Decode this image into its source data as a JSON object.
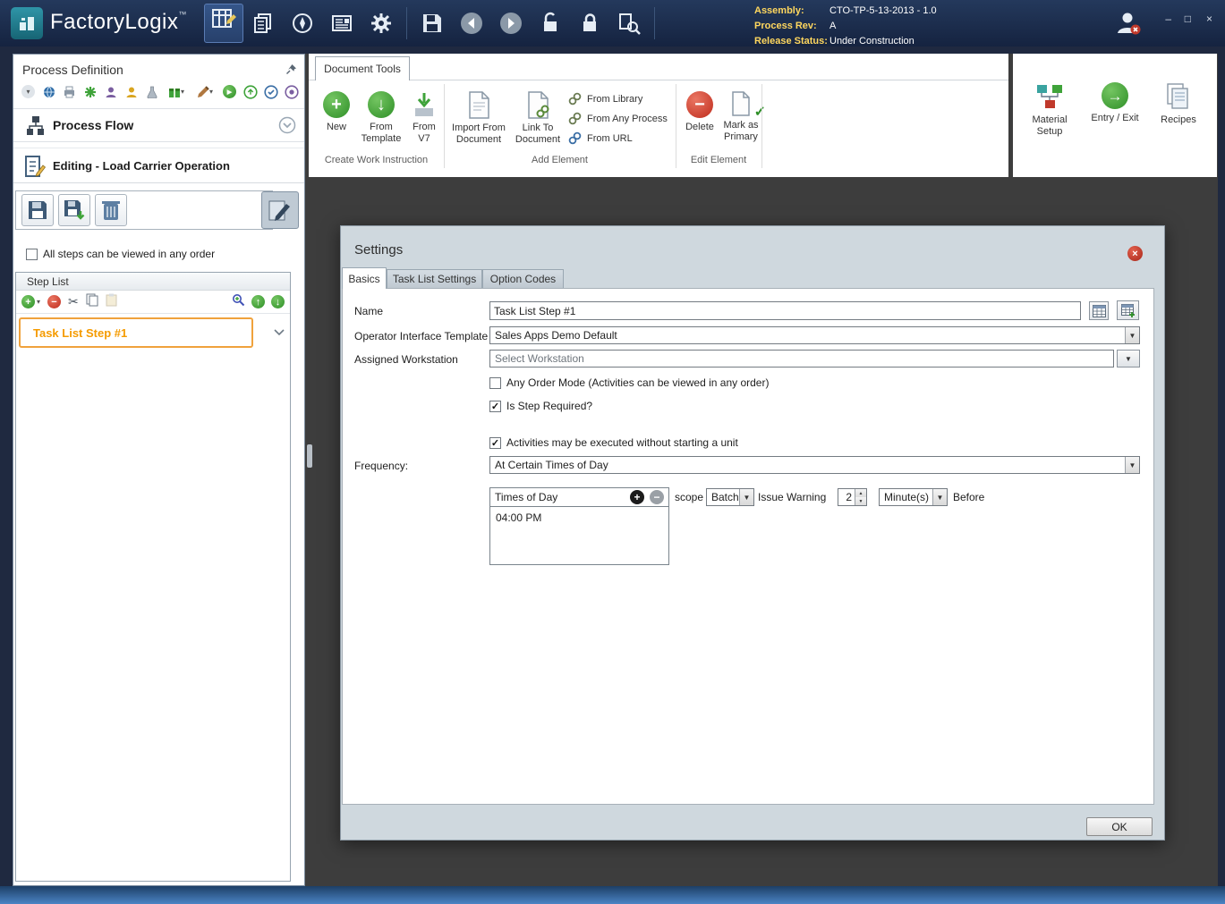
{
  "titlebar": {
    "brand": "FactoryLogix",
    "trademark": "™",
    "info": [
      {
        "label": "Assembly:",
        "value": "CTO-TP-5-13-2013 - 1.0"
      },
      {
        "label": "Process Rev:",
        "value": "A"
      },
      {
        "label": "Release Status:",
        "value": "Under Construction"
      }
    ],
    "window_buttons": {
      "minimize": "–",
      "maximize": "□",
      "close": "×"
    }
  },
  "left_panel": {
    "title": "Process Definition",
    "process_flow": "Process Flow",
    "editing": "Editing - Load Carrier Operation",
    "any_order_label": "All steps can be viewed in any order",
    "step_list_title": "Step List",
    "steps": [
      {
        "label": "Task List Step #1"
      }
    ]
  },
  "ribbon": {
    "tab": "Document Tools",
    "groups": [
      {
        "label": "Create Work Instruction"
      },
      {
        "label": "Add Element"
      },
      {
        "label": "Edit Element"
      }
    ],
    "buttons": {
      "new": "New",
      "from_template": "From Template",
      "from_v7": "From V7",
      "import_from_document": "Import From Document",
      "link_to_document": "Link To Document",
      "from_library": "From Library",
      "from_any_process": "From Any Process",
      "from_url": "From URL",
      "delete": "Delete",
      "mark_as_primary": "Mark as Primary",
      "material_setup": "Material Setup",
      "entry_exit": "Entry / Exit",
      "recipes": "Recipes"
    }
  },
  "dialog": {
    "title": "Settings",
    "tabs": [
      {
        "label": "Basics"
      },
      {
        "label": "Task List Settings"
      },
      {
        "label": "Option Codes"
      }
    ],
    "name_label": "Name",
    "name_value": "Task List Step #1",
    "template_label": "Operator Interface Template",
    "template_value": "Sales Apps Demo Default",
    "workstation_label": "Assigned Workstation",
    "workstation_placeholder": "Select Workstation",
    "any_order_mode": "Any Order Mode (Activities can be viewed in any order)",
    "is_step_required": "Is Step Required?",
    "activities_no_unit": "Activities may be executed without starting a unit",
    "frequency_label": "Frequency:",
    "frequency_value": "At Certain Times of Day",
    "times_of_day_title": "Times of Day",
    "times": [
      {
        "value": "04:00 PM"
      }
    ],
    "scope_label": "scope",
    "scope_value": "Batch",
    "issue_warning_label": "Issue Warning",
    "warning_number": "2",
    "warning_unit": "Minute(s)",
    "before_label": "Before",
    "ok": "OK"
  }
}
